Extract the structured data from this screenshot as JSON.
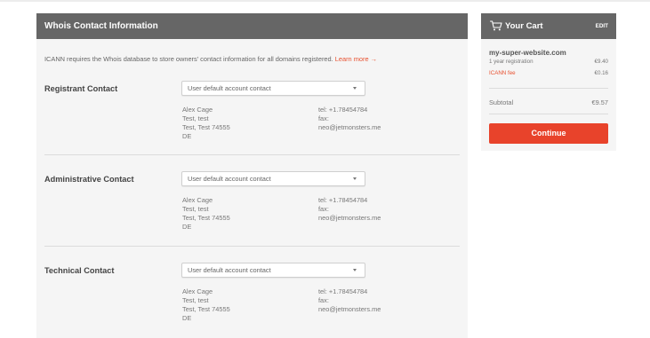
{
  "whois": {
    "title": "Whois Contact Information",
    "intro": "ICANN requires the Whois database to store owners' contact information for all domains registered.",
    "learn_more": "Learn more →",
    "contacts": [
      {
        "label": "Registrant Contact",
        "select": "User default account contact",
        "name": "Alex Cage",
        "line2": "Test, test",
        "line3": "Test, Test 74555",
        "country": "DE",
        "tel": "tel: +1.78454784",
        "fax": "fax:",
        "email": "neo@jetmonsters.me"
      },
      {
        "label": "Administrative Contact",
        "select": "User default account contact",
        "name": "Alex Cage",
        "line2": "Test, test",
        "line3": "Test, Test 74555",
        "country": "DE",
        "tel": "tel: +1.78454784",
        "fax": "fax:",
        "email": "neo@jetmonsters.me"
      },
      {
        "label": "Technical Contact",
        "select": "User default account contact",
        "name": "Alex Cage",
        "line2": "Test, test",
        "line3": "Test, Test 74555",
        "country": "DE",
        "tel": "tel: +1.78454784",
        "fax": "fax:",
        "email": "neo@jetmonsters.me"
      }
    ]
  },
  "cart": {
    "title": "Your Cart",
    "edit": "EDIT",
    "icon": "cart-icon",
    "domain": "my-super-website.com",
    "registration_label": "1 year registration",
    "registration_price": "€9.40",
    "fee_label": "ICANN fee",
    "fee_price": "€0.16",
    "subtotal_label": "Subtotal",
    "subtotal_price": "€9.57",
    "continue": "Continue"
  },
  "colors": {
    "header_bg": "#666666",
    "accent": "#e8432b",
    "panel_bg": "#f5f5f5"
  }
}
